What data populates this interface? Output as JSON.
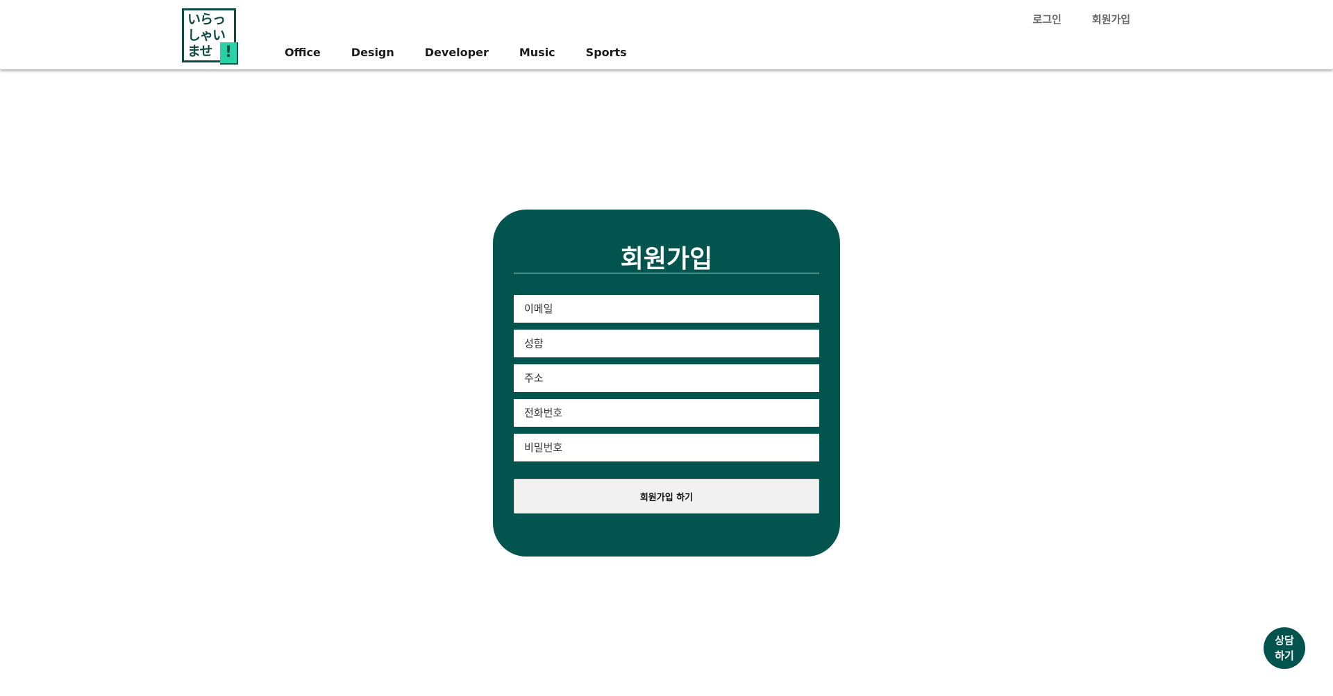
{
  "header": {
    "logo": {
      "text": "いらっしゃいませ",
      "bang": "!"
    },
    "nav": [
      {
        "label": "Office"
      },
      {
        "label": "Design"
      },
      {
        "label": "Developer"
      },
      {
        "label": "Music"
      },
      {
        "label": "Sports"
      }
    ],
    "top_links": {
      "login": "로그인",
      "signup": "회원가입"
    }
  },
  "signup_form": {
    "title": "회원가입",
    "fields": {
      "email": {
        "placeholder": "이메일",
        "value": ""
      },
      "name": {
        "placeholder": "성함",
        "value": ""
      },
      "address": {
        "placeholder": "주소",
        "value": ""
      },
      "phone": {
        "placeholder": "전화번호",
        "value": ""
      },
      "password": {
        "placeholder": "비밀번호",
        "value": ""
      }
    },
    "submit_label": "회원가입 하기"
  },
  "chat_button": {
    "label": "상담\n하기"
  },
  "colors": {
    "primary": "#03544e",
    "accent": "#2ad0a6",
    "logo_border": "#0e4a45"
  }
}
